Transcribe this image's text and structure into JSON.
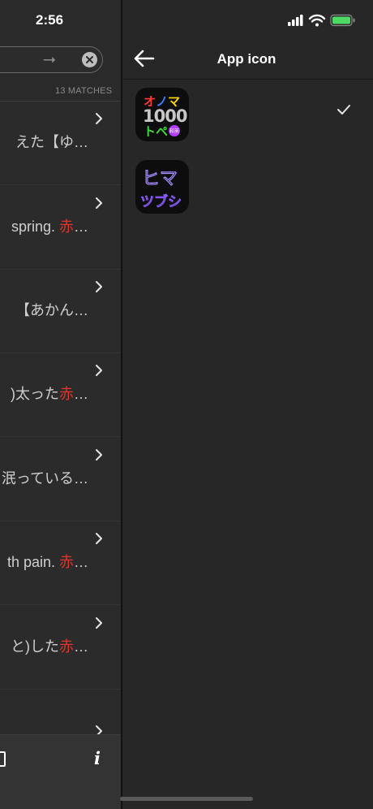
{
  "status_bar": {
    "time": "2:56"
  },
  "search": {
    "arrow_glyph": "⭢",
    "matches_label": "13 MATCHES"
  },
  "results": [
    {
      "before": "えた【ゆ…",
      "highlight": "",
      "after": ""
    },
    {
      "before": " spring. ",
      "highlight": "赤",
      "after": "…"
    },
    {
      "before": "【あかん…",
      "highlight": "",
      "after": ""
    },
    {
      "before": ")太った",
      "highlight": "赤",
      "after": "…"
    },
    {
      "before": "泯っている…",
      "highlight": "",
      "after": ""
    },
    {
      "before": "th pain. ",
      "highlight": "赤",
      "after": "…"
    },
    {
      "before": "と)した",
      "highlight": "赤",
      "after": "…"
    },
    {
      "before": "",
      "highlight": "",
      "after": ""
    }
  ],
  "toolbar": {
    "info_label": "i"
  },
  "nav": {
    "title": "App icon"
  },
  "app_icons": [
    {
      "name": "onomatope-1000",
      "line1": "オノマ",
      "line2": "1000",
      "line3": "トペ",
      "badge": "和英",
      "selected": true
    },
    {
      "name": "himatsubushi",
      "line1": "ヒマ",
      "line2": "ツブシ",
      "selected": false
    }
  ],
  "colors": {
    "highlight_red": "#e0352b",
    "battery_green": "#4cd964",
    "panel_bg": "#272727"
  }
}
